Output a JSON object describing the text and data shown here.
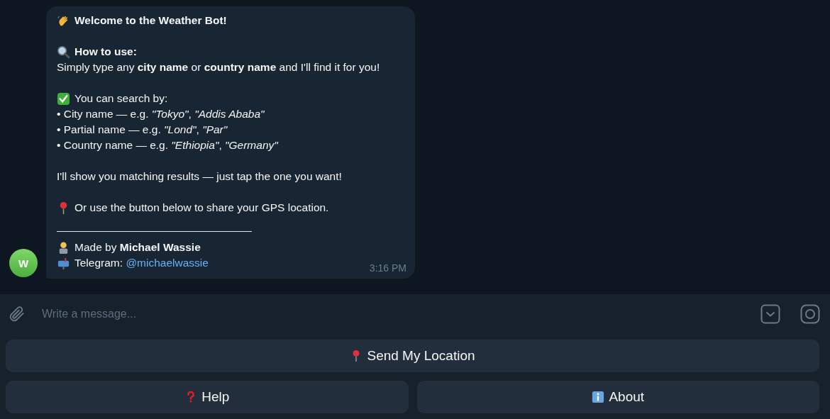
{
  "message": {
    "avatar": "W",
    "time": "3:16 PM",
    "paragraphs": [
      [
        {
          "kind": "title",
          "text": "Welcome to the Weather Bot!"
        }
      ],
      [
        {
          "kind": "heading",
          "text": "How to use:"
        },
        {
          "kind": "text",
          "text": "Simply type any **city name** or **country name** and I'll find it for you!"
        }
      ],
      [
        {
          "kind": "check",
          "text": "You can search by:"
        },
        {
          "kind": "text",
          "text": "• City name — e.g. *\"Tokyo\"*, *\"Addis Ababa\"*"
        },
        {
          "kind": "text",
          "text": "• Partial name — e.g. *\"Lond\"*, *\"Par\"*"
        },
        {
          "kind": "text",
          "text": "• Country name — e.g. *\"Ethiopia\"*, *\"Germany\"*"
        }
      ],
      [
        {
          "kind": "text",
          "text": "I'll show you matching results — just tap the one you want!"
        }
      ],
      [
        {
          "kind": "pin",
          "text": "Or use the button below to share your GPS location."
        }
      ],
      [
        {
          "kind": "rule"
        },
        {
          "kind": "author",
          "text": "Made by **Michael Wassie**"
        },
        {
          "kind": "contact",
          "text": "Telegram: ",
          "link": "@michaelwassie"
        }
      ]
    ]
  },
  "composer": {
    "placeholder": "Write a message..."
  },
  "keyboard": [
    [
      {
        "kind": "pin",
        "label": "Send My Location"
      }
    ],
    [
      {
        "kind": "question",
        "label": "Help"
      },
      {
        "kind": "info",
        "label": "About"
      }
    ]
  ]
}
